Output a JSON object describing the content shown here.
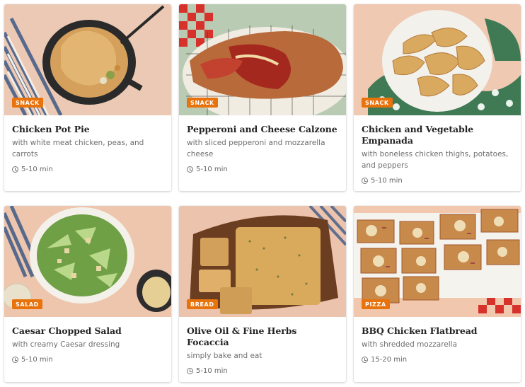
{
  "cards": [
    {
      "title": "Chicken Pot Pie",
      "subtitle": "with white meat chicken, peas, and carrots",
      "tag": "SNACK",
      "time": "5-10 min",
      "image": "chicken-pot-pie-photo"
    },
    {
      "title": "Pepperoni and Cheese Calzone",
      "subtitle": "with sliced pepperoni and mozzarella cheese",
      "tag": "SNACK",
      "time": "5-10 min",
      "image": "calzone-photo"
    },
    {
      "title": "Chicken and Vegetable Empanada",
      "subtitle": "with boneless chicken thighs, potatoes, and peppers",
      "tag": "SNACK",
      "time": "5-10 min",
      "image": "empanada-photo"
    },
    {
      "title": "Caesar Chopped Salad",
      "subtitle": "with creamy Caesar dressing",
      "tag": "SALAD",
      "time": "5-10 min",
      "image": "caesar-salad-photo"
    },
    {
      "title": "Olive Oil & Fine Herbs Focaccia",
      "subtitle": "simply bake and eat",
      "tag": "BREAD",
      "time": "5-10 min",
      "image": "focaccia-photo"
    },
    {
      "title": "BBQ Chicken Flatbread",
      "subtitle": "with shredded mozzarella",
      "tag": "PIZZA",
      "time": "15-20 min",
      "image": "flatbread-photo"
    }
  ],
  "colors": {
    "tag_bg": "#e8720c",
    "title": "#242424",
    "subtitle": "#6e6e6e",
    "card_bg": "#ffffff"
  },
  "icons": {
    "time": "clock-icon"
  }
}
